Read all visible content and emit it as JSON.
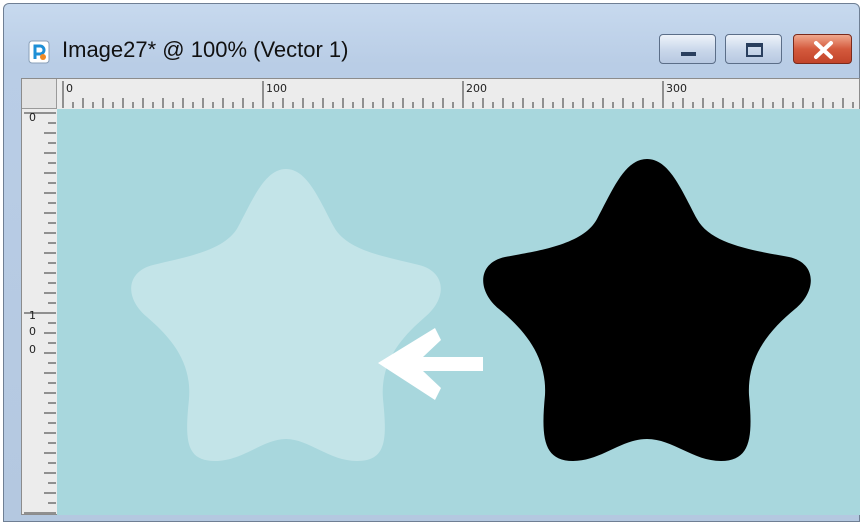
{
  "window": {
    "title": "Image27* @ 100% (Vector 1)",
    "icon": "paintshop-pro-app-icon",
    "controls": [
      "minimize-button",
      "maximize-button",
      "close-button"
    ]
  },
  "rulers": {
    "horizontal_labels": [
      "0",
      "100",
      "200",
      "300"
    ],
    "vertical_labels": [
      "0",
      "1",
      "0",
      "0"
    ]
  },
  "canvas": {
    "background_color": "#a8d7dd",
    "shapes": [
      {
        "name": "faded-star",
        "color": "#c3e4e8"
      },
      {
        "name": "black-star",
        "color": "#000000"
      },
      {
        "name": "arrow-left",
        "color": "#ffffff"
      }
    ]
  },
  "colors": {
    "close_button": "#d45a3d",
    "titlebar": "#c7d9ee"
  }
}
